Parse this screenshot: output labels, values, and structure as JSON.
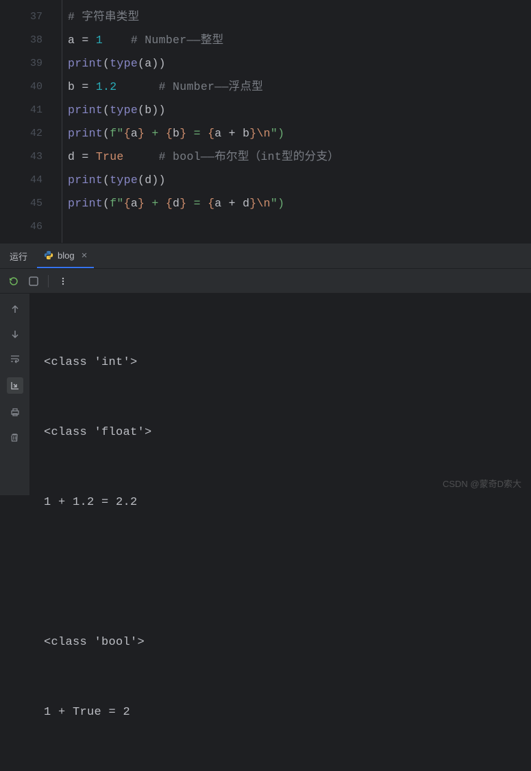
{
  "editor": {
    "line_numbers": [
      "37",
      "38",
      "39",
      "40",
      "41",
      "42",
      "43",
      "44",
      "45",
      "46"
    ],
    "lines": {
      "l37_comment": "# 字符串类型",
      "l38_var": "a",
      "l38_eq": " = ",
      "l38_val": "1",
      "l38_pad": "    ",
      "l38_comment": "# Number——整型",
      "l39_fn": "print",
      "l39_open": "(",
      "l39_type": "type",
      "l39_arg": "(a))",
      "l40_var": "b",
      "l40_eq": " = ",
      "l40_val": "1.2",
      "l40_pad": "      ",
      "l40_comment": "# Number——浮点型",
      "l41_fn": "print",
      "l41_open": "(",
      "l41_type": "type",
      "l41_arg": "(b))",
      "l42_fn": "print",
      "l42_open": "(",
      "l42_f": "f\"",
      "l42_b1": "{",
      "l42_a": "a",
      "l42_b2": "}",
      "l42_s1": " + ",
      "l42_b3": "{",
      "l42_b": "b",
      "l42_b4": "}",
      "l42_s2": " = ",
      "l42_b5": "{",
      "l42_expr": "a + b",
      "l42_b6": "}",
      "l42_esc": "\\n",
      "l42_end": "\")",
      "l43_var": "d",
      "l43_eq": " = ",
      "l43_val": "True",
      "l43_pad": "     ",
      "l43_comment": "# bool——布尔型（int型的分支）",
      "l44_fn": "print",
      "l44_open": "(",
      "l44_type": "type",
      "l44_arg": "(d))",
      "l45_fn": "print",
      "l45_open": "(",
      "l45_f": "f\"",
      "l45_b1": "{",
      "l45_a": "a",
      "l45_b2": "}",
      "l45_s1": " + ",
      "l45_b3": "{",
      "l45_d": "d",
      "l45_b4": "}",
      "l45_s2": " = ",
      "l45_b5": "{",
      "l45_expr": "a + d",
      "l45_b6": "}",
      "l45_esc": "\\n",
      "l45_end": "\")"
    }
  },
  "tabs": {
    "run_label": "运行",
    "active_tab": "blog"
  },
  "console": {
    "out1": "<class 'int'>",
    "out2": "<class 'float'>",
    "out3": "1 + 1.2 = 2.2",
    "out4": "",
    "out5": "<class 'bool'>",
    "out6": "1 + True = 2"
  },
  "watermark": "CSDN @蒙奇D索大"
}
